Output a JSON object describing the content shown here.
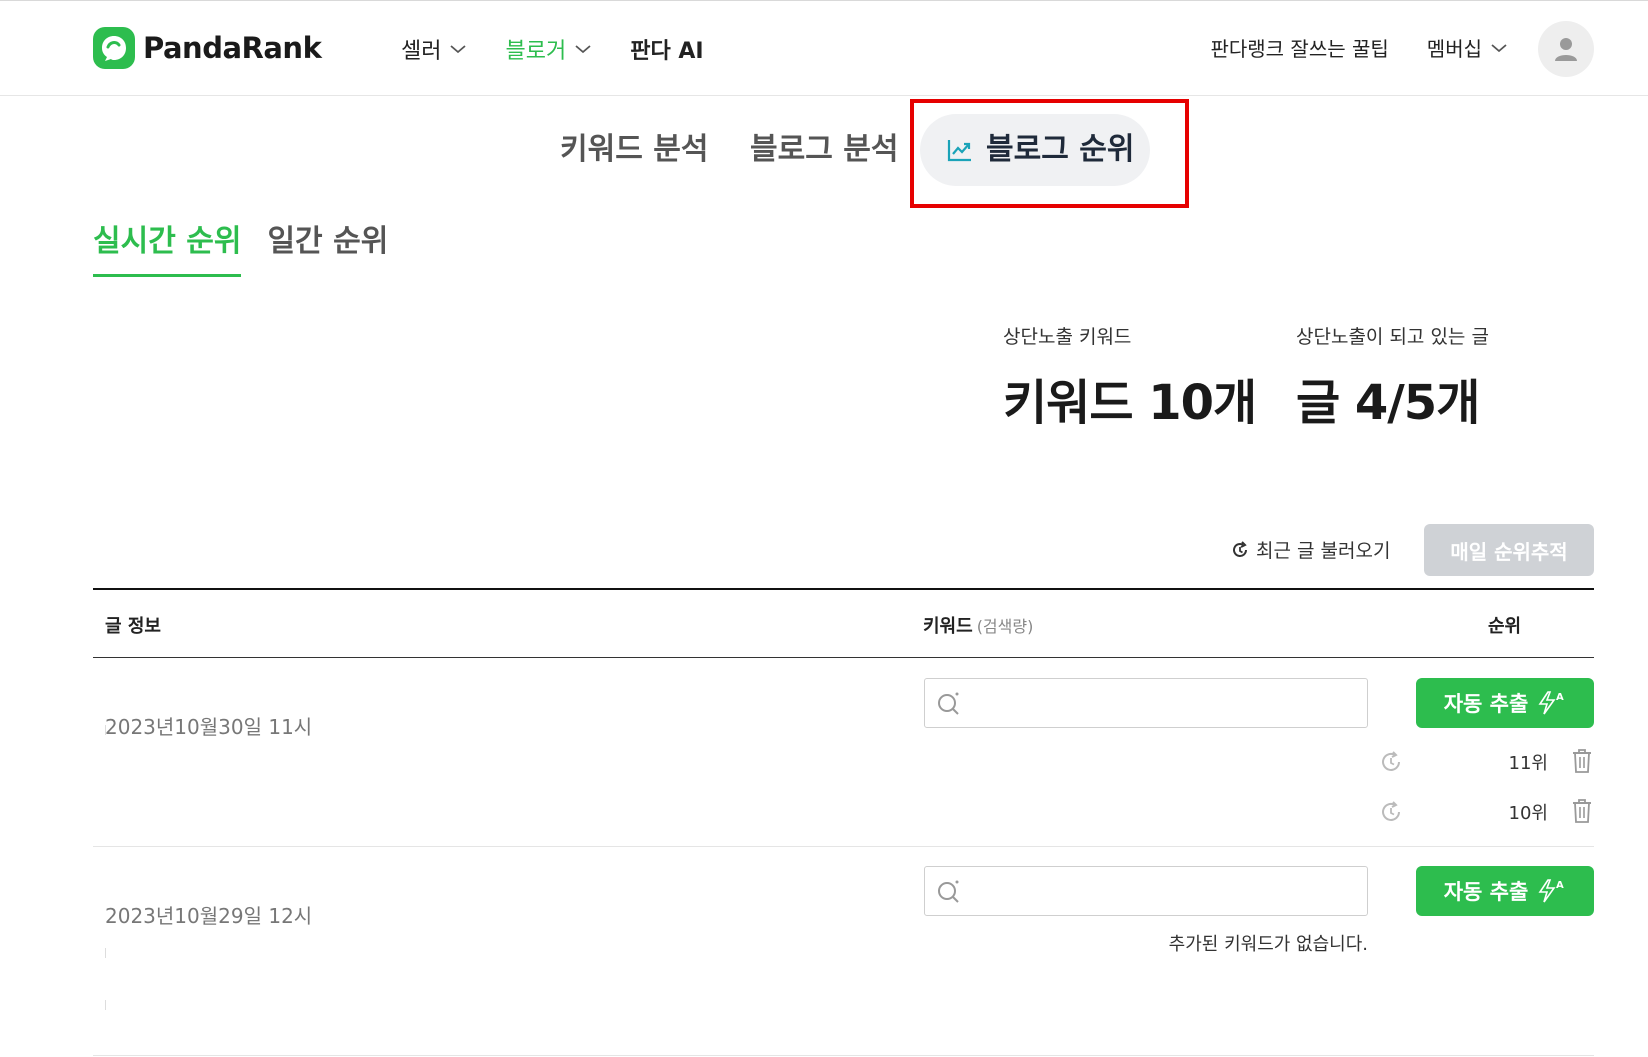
{
  "header": {
    "brand": "PandaRank",
    "nav": [
      {
        "label": "셀러",
        "has_dropdown": true,
        "active": false
      },
      {
        "label": "블로거",
        "has_dropdown": true,
        "active": true
      },
      {
        "label": "판다 AI",
        "has_dropdown": false,
        "active": false
      }
    ],
    "tips_link": "판다랭크 잘쓰는 꿀팁",
    "membership": "멤버십",
    "avatar_icon": "user-icon"
  },
  "subtabs": {
    "keyword_analysis": "키워드 분석",
    "blog_analysis": "블로그 분석",
    "blog_rank": "블로그 순위"
  },
  "rank_tabs": {
    "realtime": "실시간 순위",
    "daily": "일간 순위"
  },
  "stats": {
    "top_keywords_label": "상단노출 키워드",
    "top_keywords_value": "키워드 10개",
    "top_posts_label": "상단노출이 되고 있는 글",
    "top_posts_value": "글 4/5개"
  },
  "toolbar": {
    "load_recent": "최근 글 불러오기",
    "track_daily": "매일 순위추적"
  },
  "table": {
    "col_info": "글 정보",
    "col_keyword": "키워드",
    "col_keyword_sub": "(검색량)",
    "col_rank": "순위",
    "auto_extract": "자동 추출",
    "rows": [
      {
        "date": "2023년10월30일 11시",
        "keyword_value": "",
        "ranks": [
          {
            "value": "11위"
          },
          {
            "value": "10위"
          }
        ]
      },
      {
        "date": "2023년10월29일 12시",
        "keyword_value": "",
        "empty_message": "추가된 키워드가 없습니다."
      }
    ]
  },
  "colors": {
    "brand_green": "#2dbd4e",
    "highlight_red": "#e60000",
    "disabled_button": "#cfd2d6"
  }
}
